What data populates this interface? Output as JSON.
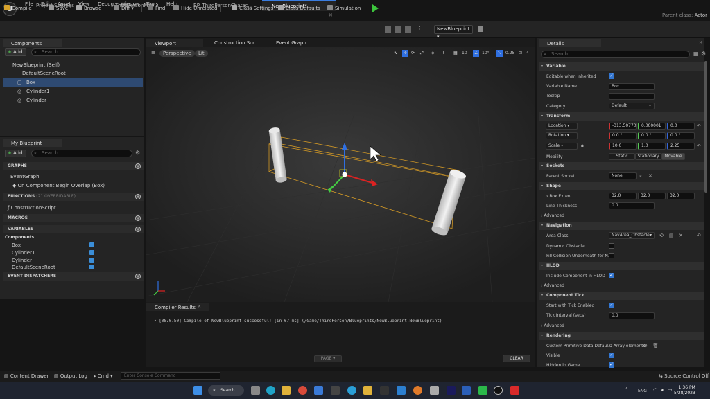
{
  "app": {
    "logo": "U"
  },
  "menu": [
    "File",
    "Edit",
    "Asset",
    "View",
    "Debug",
    "Window",
    "Tools",
    "Help"
  ],
  "doc_tabs": [
    "Project Settings",
    "ThirdPersonMap",
    "BP_ThirdPersonCharac...",
    "NewBlueprint*"
  ],
  "parent_class": {
    "label": "Parent class:",
    "value": "Actor"
  },
  "toolbar": {
    "compile": "Compile",
    "save": "Save",
    "browse": "Browse",
    "diff": "Diff",
    "find": "Find",
    "hide_unrelated": "Hide Unrelated",
    "class_settings": "Class Settings",
    "class_defaults": "Class Defaults",
    "simulation": "Simulation",
    "blueprint_select": "NewBlueprint"
  },
  "components": {
    "tab": "Components",
    "add": "Add",
    "search_placeholder": "Search",
    "tree": [
      "NewBlueprint (Self)",
      "DefaultSceneRoot",
      "Box",
      "Cylinder1",
      "Cylinder"
    ]
  },
  "my_blueprint": {
    "tab": "My Blueprint",
    "add": "Add",
    "search_placeholder": "Search",
    "graphs": "GRAPHS",
    "event_graph": "EventGraph",
    "event": "On Component Begin Overlap (Box)",
    "functions": "FUNCTIONS",
    "functions_note": "(21 OVERRIDABLE)",
    "construction": "ConstructionScript",
    "macros": "MACROS",
    "variables": "VARIABLES",
    "components_group": "Components",
    "vars": [
      "Box",
      "Cylinder1",
      "Cylinder",
      "DefaultSceneRoot"
    ],
    "dispatchers": "EVENT DISPATCHERS"
  },
  "center_tabs": [
    "Viewport",
    "Construction Scr...",
    "Event Graph"
  ],
  "viewport": {
    "perspective": "Perspective",
    "lit": "Lit",
    "grid_snap": "10",
    "rot_snap": "10°",
    "scale_snap": "0.25",
    "cam_speed": "4"
  },
  "compiler": {
    "tab": "Compiler Results",
    "message": "• [0870.50] Compile of NewBlueprint successful! [in 67 ms] (/Game/ThirdPerson/Blueprints/NewBlueprint.NewBlueprint)",
    "page": "PAGE",
    "clear": "CLEAR"
  },
  "details": {
    "tab": "Details",
    "search_placeholder": "Search",
    "variable": "Variable",
    "editable": "Editable when Inherited",
    "var_name_label": "Variable Name",
    "var_name": "Box",
    "tooltip": "Tooltip",
    "category_label": "Category",
    "category": "Default",
    "transform": "Transform",
    "location": "Location",
    "loc": [
      "-313.507702",
      "0.000001",
      "0.0"
    ],
    "rotation": "Rotation",
    "rot": [
      "0.0 °",
      "0.0 °",
      "0.0 °"
    ],
    "scale": "Scale",
    "scl": [
      "10.0",
      "1.0",
      "2.25"
    ],
    "mobility": "Mobility",
    "mob": [
      "Static",
      "Stationary",
      "Movable"
    ],
    "sockets": "Sockets",
    "parent_socket": "Parent Socket",
    "parent_socket_val": "None",
    "shape": "Shape",
    "box_extent": "Box Extent",
    "ext": [
      "32.0",
      "32.0",
      "32.0"
    ],
    "line_thickness": "Line Thickness",
    "line_val": "0.0",
    "advanced": "Advanced",
    "navigation": "Navigation",
    "area_class": "Area Class",
    "area_val": "NavArea_Obstacle",
    "dyn_obstacle": "Dynamic Obstacle",
    "fill_collision": "Fill Collision Underneath for N...",
    "hlod": "HLOD",
    "include_hlod": "Include Component in HLOD",
    "tick": "Component Tick",
    "start_tick": "Start with Tick Enabled",
    "tick_interval": "Tick Interval (secs)",
    "tick_val": "0.0",
    "rendering": "Rendering",
    "custom_prim": "Custom Primitive Data Defaul...",
    "array_val": "0 Array elements",
    "visible": "Visible",
    "hidden_game": "Hidden in Game"
  },
  "statusbar": {
    "content_drawer": "Content Drawer",
    "output_log": "Output Log",
    "cmd": "Cmd",
    "console_placeholder": "Enter Console Command",
    "source_control": "Source Control Off"
  },
  "taskbar": {
    "search": "Search",
    "lang": "ENG",
    "time": "1:36 PM",
    "date": "5/28/2023"
  }
}
